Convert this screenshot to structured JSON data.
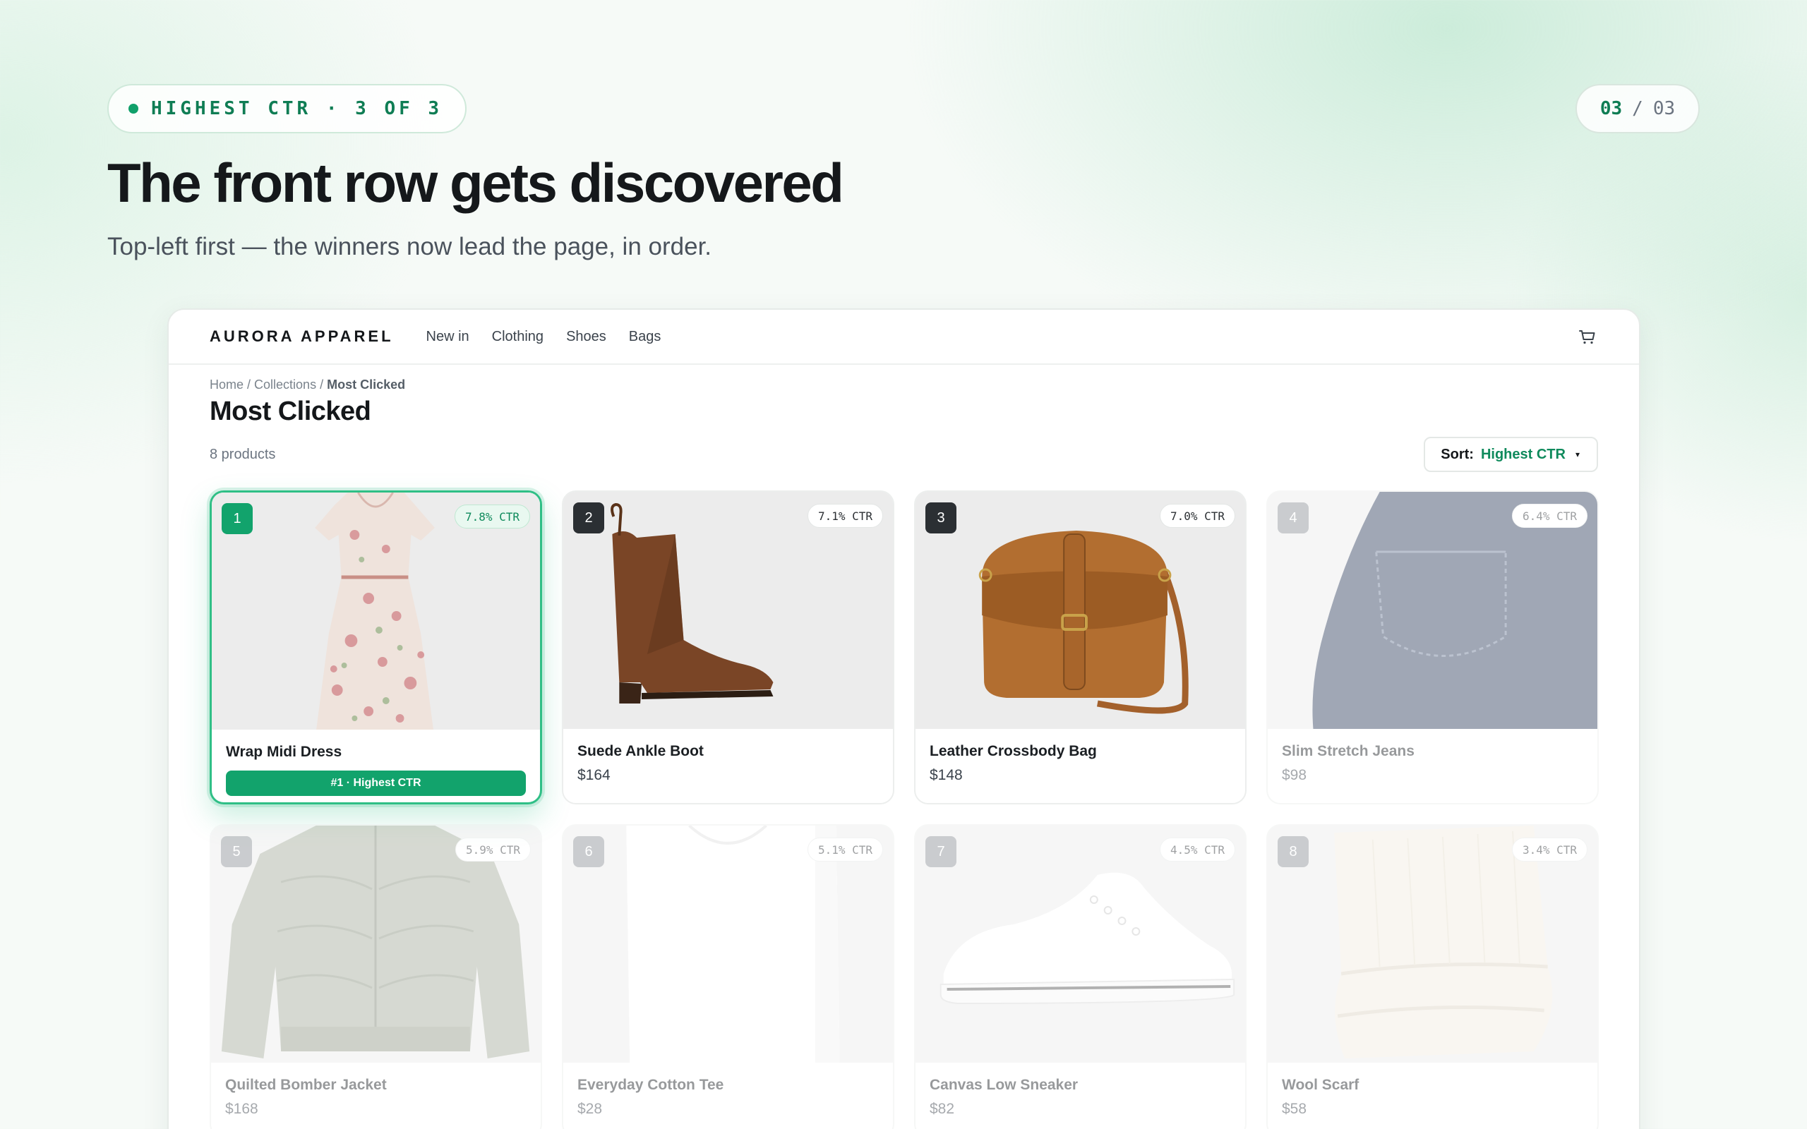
{
  "slide": {
    "tag": "HIGHEST CTR · 3 OF 3",
    "counter_current": "03",
    "counter_sep": "/",
    "counter_total": "03",
    "title": "The front row gets discovered",
    "subtitle": "Top-left first — the winners now lead the page, in order."
  },
  "store": {
    "brand": "AURORA APPAREL",
    "nav": [
      "New in",
      "Clothing",
      "Shoes",
      "Bags"
    ],
    "breadcrumb": {
      "home": "Home",
      "sep1": " / ",
      "collections": "Collections",
      "sep2": " / ",
      "current": "Most Clicked"
    },
    "page_title": "Most Clicked",
    "product_count": "8 products",
    "sort": {
      "label": "Sort:",
      "value": "Highest CTR",
      "caret": "▾"
    }
  },
  "products": [
    {
      "rank": "1",
      "ctr": "7.8% CTR",
      "name": "Wrap Midi Dress",
      "price": "",
      "badge": "#1 · Highest CTR",
      "image": "dress"
    },
    {
      "rank": "2",
      "ctr": "7.1% CTR",
      "name": "Suede Ankle Boot",
      "price": "$164",
      "image": "boot"
    },
    {
      "rank": "3",
      "ctr": "7.0% CTR",
      "name": "Leather Crossbody Bag",
      "price": "$148",
      "image": "bag"
    },
    {
      "rank": "4",
      "ctr": "6.4% CTR",
      "name": "Slim Stretch Jeans",
      "price": "$98",
      "image": "jeans"
    },
    {
      "rank": "5",
      "ctr": "5.9% CTR",
      "name": "Quilted Bomber Jacket",
      "price": "$168",
      "image": "jacket"
    },
    {
      "rank": "6",
      "ctr": "5.1% CTR",
      "name": "Everyday Cotton Tee",
      "price": "$28",
      "image": "tee"
    },
    {
      "rank": "7",
      "ctr": "4.5% CTR",
      "name": "Canvas Low Sneaker",
      "price": "$82",
      "image": "sneaker"
    },
    {
      "rank": "8",
      "ctr": "3.4% CTR",
      "name": "Wool Scarf",
      "price": "$58",
      "image": "scarf"
    }
  ],
  "colors": {
    "accent": "#12a36c",
    "accent_dark": "#0f7d54",
    "ink": "#14171a"
  }
}
